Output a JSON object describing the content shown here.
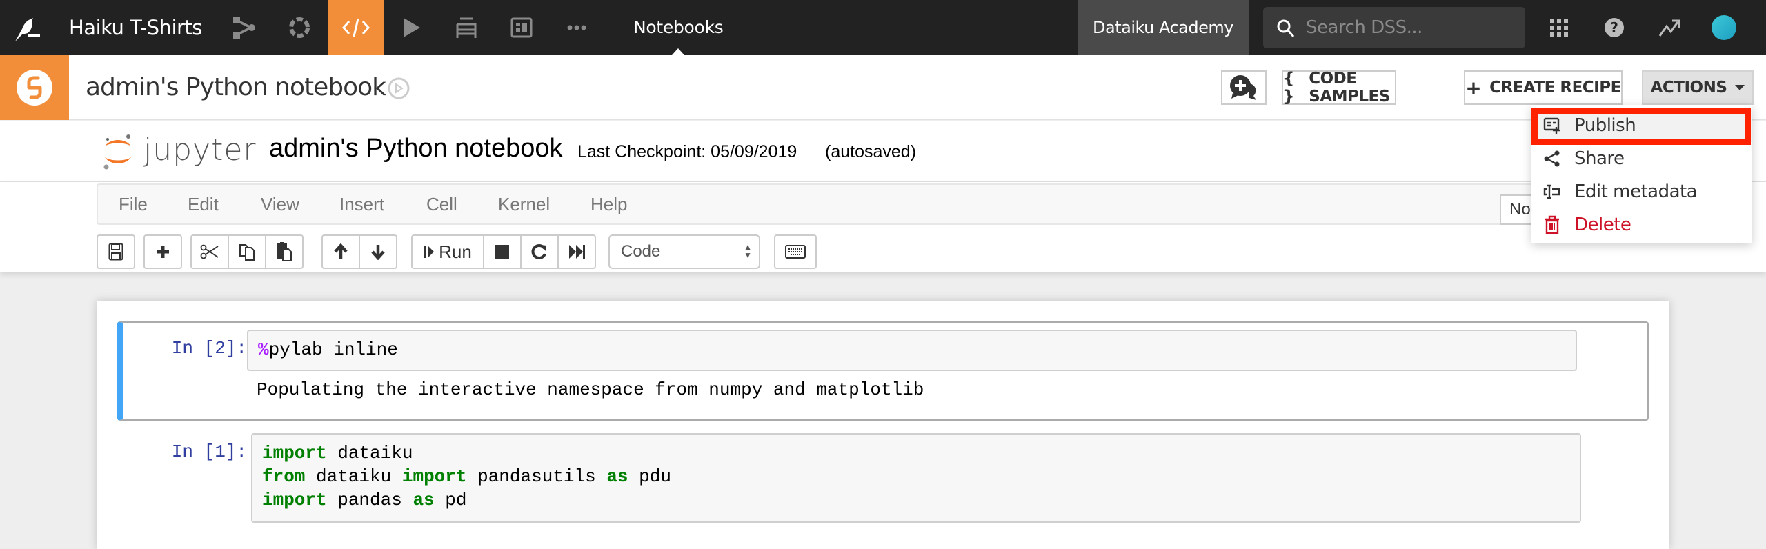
{
  "navbar": {
    "project_name": "Haiku T-Shirts",
    "icons": [
      "flow-icon",
      "recipes-cycle-icon",
      "code-icon",
      "run-jobs-icon",
      "datasets-stack-icon",
      "dashboard-icon",
      "more-icon"
    ],
    "active_icon": "code-icon",
    "section": "Notebooks",
    "academy_label": "Dataiku Academy",
    "search_placeholder": "Search DSS...",
    "right_icons": [
      "apps-grid-icon",
      "help-icon",
      "activity-icon",
      "user-avatar"
    ]
  },
  "notebook_header": {
    "title": "admin's Python notebook",
    "buttons": {
      "discuss_label": "",
      "code_samples_label": "CODE SAMPLES",
      "code_samples_glyph": "{ }",
      "create_recipe_label": "CREATE RECIPE",
      "create_recipe_glyph": "+",
      "actions_label": "ACTIONS"
    }
  },
  "actions_menu": {
    "items": [
      {
        "label": "Publish",
        "icon": "publish-icon",
        "highlighted": true
      },
      {
        "label": "Share",
        "icon": "share-icon"
      },
      {
        "label": "Edit metadata",
        "icon": "edit-metadata-icon"
      },
      {
        "label": "Delete",
        "icon": "trash-icon",
        "danger": true
      }
    ]
  },
  "jupyter": {
    "logo_text": "jupyter",
    "notebook_name": "admin's Python notebook",
    "checkpoint": "Last Checkpoint: 05/09/2019",
    "autosave": "(autosaved)",
    "menu": [
      "File",
      "Edit",
      "View",
      "Insert",
      "Cell",
      "Kernel",
      "Help"
    ],
    "trust_status": "Not Trusted",
    "toolbar": {
      "run_label": "Run",
      "cell_type": "Code"
    }
  },
  "cells": [
    {
      "prompt": "In [2]:",
      "magic": "%",
      "code_rest": "pylab inline",
      "output": "Populating the interactive namespace from numpy and matplotlib"
    },
    {
      "prompt": "In [1]:",
      "lines": [
        [
          {
            "t": "import",
            "kw": true
          },
          {
            "t": " dataiku"
          }
        ],
        [
          {
            "t": "from",
            "kw": true
          },
          {
            "t": " dataiku "
          },
          {
            "t": "import",
            "kw": true
          },
          {
            "t": " pandasutils "
          },
          {
            "t": "as",
            "kw": true
          },
          {
            "t": " pdu"
          }
        ],
        [
          {
            "t": "import",
            "kw": true
          },
          {
            "t": " pandas "
          },
          {
            "t": "as",
            "kw": true
          },
          {
            "t": " pd"
          }
        ]
      ]
    }
  ],
  "colors": {
    "accent_orange": "#f28d39",
    "navbar_bg": "#222222",
    "selected_cell_bar": "#42a5f5",
    "danger": "#ce1228",
    "highlight_box": "#ff2200"
  }
}
